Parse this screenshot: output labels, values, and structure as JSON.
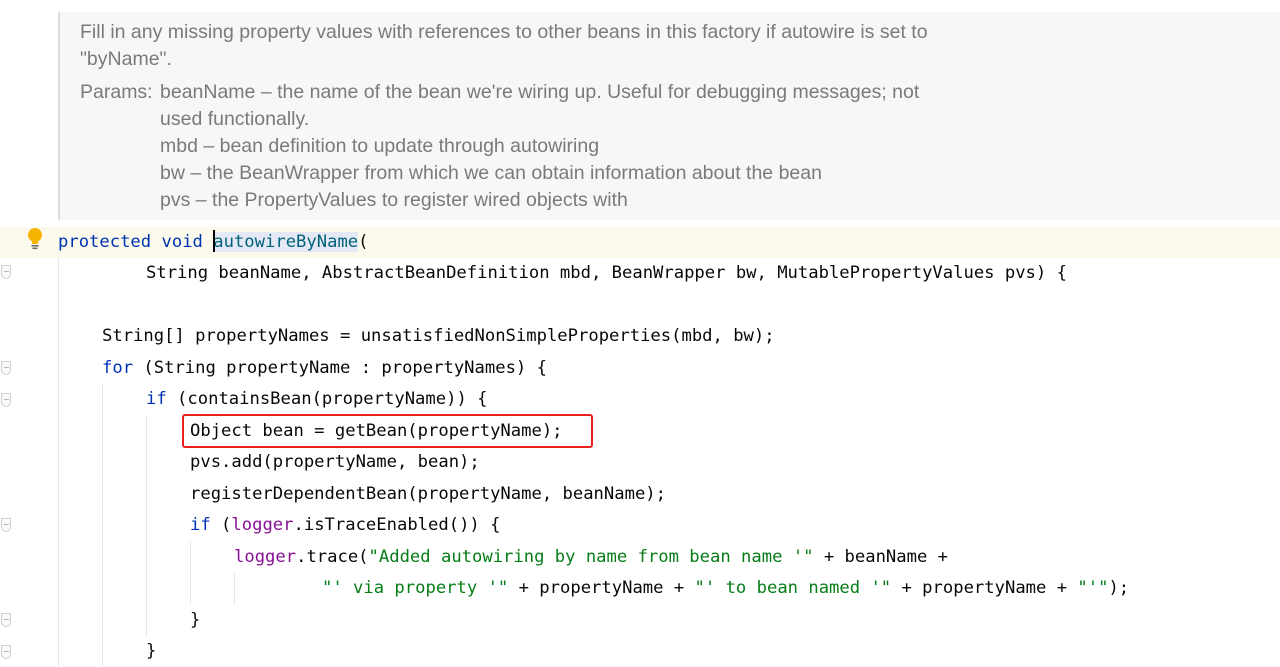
{
  "javadoc": {
    "desc_line1": "Fill in any missing property values with references to other beans in this factory if autowire is set to",
    "desc_line2": "\"byName\".",
    "params_label": "Params:",
    "params": [
      "beanName – the name of the bean we're wiring up. Useful for debugging messages; not",
      "used functionally.",
      "mbd – bean definition to update through autowiring",
      "bw – the BeanWrapper from which we can obtain information about the bean",
      "pvs – the PropertyValues to register wired objects with"
    ]
  },
  "code": {
    "l1_kw1": "protected",
    "l1_kw2": "void",
    "l1_method": "autowireByName",
    "l1_rest": "(",
    "l2": "String beanName, AbstractBeanDefinition mbd, BeanWrapper bw, MutablePropertyValues pvs) {",
    "l4": "String[] propertyNames = unsatisfiedNonSimpleProperties(mbd, bw);",
    "l5_kw": "for",
    "l5_rest": " (String propertyName : propertyNames) {",
    "l6_kw": "if",
    "l6_rest": " (containsBean(propertyName)) {",
    "l7": "Object bean = getBean(propertyName);",
    "l8": "pvs.add(propertyName, bean);",
    "l9": "registerDependentBean(propertyName, beanName);",
    "l10_kw": "if",
    "l10_p1": " (",
    "l10_field": "logger",
    "l10_p2": ".isTraceEnabled()) {",
    "l11_field": "logger",
    "l11_p1": ".trace(",
    "l11_str": "\"Added autowiring by name from bean name '\"",
    "l11_p2": " + beanName +",
    "l12_str1": "\"' via property '\"",
    "l12_p1": " + propertyName + ",
    "l12_str2": "\"' to bean named '\"",
    "l12_p2": " + propertyName + ",
    "l12_str3": "\"'\"",
    "l12_p3": ");",
    "l13": "}",
    "l14": "}"
  },
  "icons": {
    "intention_bulb": "lightbulb-icon",
    "fold": "fold-marker-icon"
  },
  "colors": {
    "keyword": "#0033b3",
    "string": "#067d17",
    "field": "#871094",
    "method_declaration": "#00627a",
    "highlight_box": "#e8201f",
    "javadoc_text": "#7a7a7a"
  }
}
